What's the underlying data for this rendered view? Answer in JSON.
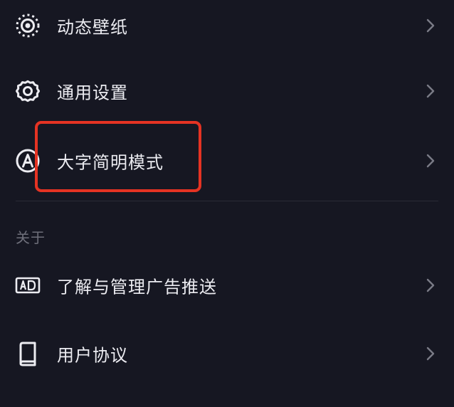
{
  "settings": {
    "items": [
      {
        "label": "动态壁纸",
        "icon": "live-wallpaper-icon"
      },
      {
        "label": "通用设置",
        "icon": "gear-icon"
      },
      {
        "label": "大字简明模式",
        "icon": "large-font-icon"
      }
    ]
  },
  "about": {
    "header": "关于",
    "items": [
      {
        "label": "了解与管理广告推送",
        "icon": "ad-icon"
      },
      {
        "label": "用户协议",
        "icon": "book-icon"
      }
    ]
  },
  "colors": {
    "background": "#161722",
    "highlight": "#e53323",
    "text": "#ececf1",
    "muted": "#6e6f7a",
    "chevron": "#7a7b86"
  }
}
